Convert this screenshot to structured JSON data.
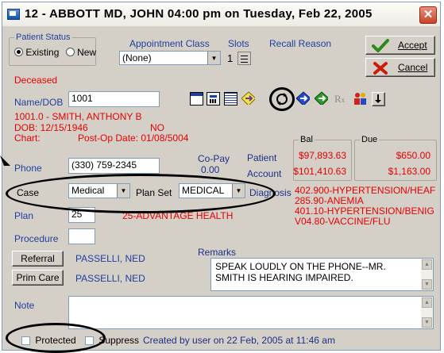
{
  "window": {
    "title": "12 - ABBOTT MD, JOHN   04:00 pm on Tuesday, Feb 22, 2005",
    "close": "✕"
  },
  "patient_status": {
    "legend": "Patient Status",
    "existing": "Existing",
    "new": "New",
    "selected": "Existing"
  },
  "appointment_class": {
    "label": "Appointment Class",
    "value": "(None)"
  },
  "slots": {
    "label": "Slots",
    "value": "1"
  },
  "recall_reason": {
    "label": "Recall Reason"
  },
  "buttons": {
    "accept": "Accept",
    "cancel": "Cancel",
    "referral": "Referral",
    "prim_care": "Prim Care"
  },
  "deceased": "Deceased",
  "name_dob": {
    "label": "Name/DOB",
    "value": "1001"
  },
  "patient_info": {
    "line1": "1001.0 - SMITH, ANTHONY B",
    "dob": "DOB: 12/15/1946",
    "no": "NO",
    "chart": "Chart:",
    "post_op": "Post-Op Date: 01/08/5004"
  },
  "phone": {
    "label": "Phone",
    "value": "(330) 759-2345"
  },
  "copay": {
    "label": "Co-Pay",
    "value": "0.00"
  },
  "balances": {
    "patient_label": "Patient",
    "account_label": "Account",
    "bal_label": "Bal",
    "due_label": "Due",
    "patient_bal": "$97,893.63",
    "patient_due": "$650.00",
    "account_bal": "$101,410.63",
    "account_due": "$1,163.00"
  },
  "case": {
    "label": "Case",
    "value": "Medical"
  },
  "plan_set": {
    "label": "Plan Set",
    "value": "MEDICAL"
  },
  "diagnosis": {
    "label": "Diagnosis",
    "items": [
      "402.900-HYPERTENSION/HEAF",
      "285.90-ANEMIA",
      "401.10-HYPERTENSION/BENIG",
      "V04.80-VACCINE/FLU"
    ]
  },
  "plan": {
    "label": "Plan",
    "value": "25",
    "name": "25-ADVANTAGE HEALTH"
  },
  "procedure": {
    "label": "Procedure",
    "value": ""
  },
  "referral_name": "PASSELLI, NED",
  "prim_care_name": "PASSELLI, NED",
  "remarks": {
    "label": "Remarks",
    "line1": "SPEAK LOUDLY ON THE PHONE--MR.",
    "line2": "SMITH IS HEARING IMPAIRED."
  },
  "note": {
    "label": "Note",
    "value": ""
  },
  "footer": {
    "protected": "Protected",
    "suppress": "Suppress",
    "created": "Created by user on 22 Feb, 2005 at 11:46 am"
  },
  "toolbar_icons": [
    "window-icon",
    "calculator-icon",
    "calendar-grid-icon",
    "diamond-arrow-icon",
    "refresh-icon",
    "blue-diamond-icon",
    "green-diamond-icon",
    "rx-icon",
    "people-icon",
    "down-arrow-icon"
  ],
  "colors": {
    "alert_red": "#e60000",
    "label_blue": "#1f3f9f",
    "window_bg": "#d4d0c8"
  }
}
